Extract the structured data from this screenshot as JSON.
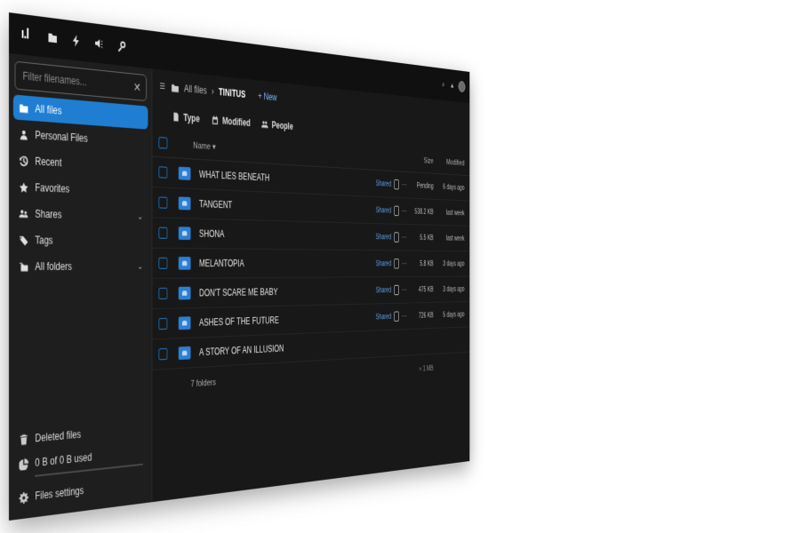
{
  "header": {
    "logo": "ı.l",
    "apps": [
      "files-icon",
      "activity-icon",
      "talk-icon",
      "search-icon"
    ]
  },
  "sidebar": {
    "filter_placeholder": "Filter filenames...",
    "items": [
      {
        "label": "All files",
        "icon": "folder-icon",
        "active": true
      },
      {
        "label": "Personal Files",
        "icon": "person-icon"
      },
      {
        "label": "Recent",
        "icon": "history-icon"
      },
      {
        "label": "Favorites",
        "icon": "star-icon"
      },
      {
        "label": "Shares",
        "icon": "share-icon",
        "expandable": true
      },
      {
        "label": "Tags",
        "icon": "tag-icon"
      },
      {
        "label": "All folders",
        "icon": "folders-icon",
        "expandable": true
      }
    ],
    "bottom": {
      "deleted": "Deleted files",
      "quota": "0 B of 0 B used",
      "settings": "Files settings"
    }
  },
  "main": {
    "breadcrumb_root": "All files",
    "breadcrumb_current": "TINITUS",
    "new_label": "+ New",
    "filters": [
      "Type",
      "Modified",
      "People"
    ],
    "columns": {
      "name": "Name ▾",
      "size": "Size",
      "modified": "Modified"
    },
    "rows": [
      {
        "name": "WHAT LIES BENEATH",
        "shared": "Shared",
        "size": "Pending",
        "modified": "6 days ago"
      },
      {
        "name": "TANGENT",
        "shared": "Shared",
        "size": "538.2 KB",
        "modified": "last week"
      },
      {
        "name": "SHONA",
        "shared": "Shared",
        "size": "5.5 KB",
        "modified": "last week"
      },
      {
        "name": "MELANTOPIA",
        "shared": "Shared",
        "size": "5.8 KB",
        "modified": "3 days ago"
      },
      {
        "name": "DON'T SCARE ME BABY",
        "shared": "Shared",
        "size": "475 KB",
        "modified": "3 days ago"
      },
      {
        "name": "ASHES OF THE FUTURE",
        "shared": "Shared",
        "size": "726 KB",
        "modified": "5 days ago"
      },
      {
        "name": "A STORY OF AN ILLUSION",
        "shared": "",
        "size": "",
        "modified": ""
      }
    ],
    "summary": "7 folders",
    "summary_size": "≈ 1 MB"
  },
  "colors": {
    "accent": "#1f7ed1",
    "background": "#181818",
    "sidebar": "#1e1e1e"
  }
}
